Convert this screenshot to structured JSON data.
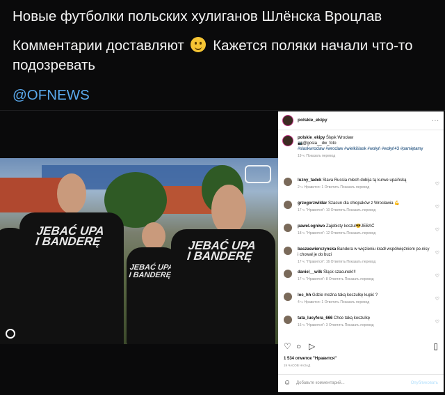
{
  "post": {
    "line1": "Новые футболки польских хулиганов Шлёнска Вроцлав",
    "line2_a": "Комментарии доставляют",
    "emoji": "smiling-face",
    "line2_b": "Кажется поляки начали что-то подозревать",
    "handle": "@OFNEWS"
  },
  "photo": {
    "shirt_text_1": "JEBAĆ UPA",
    "shirt_text_2": "I BANDERĘ",
    "shirt_text_3": "JEBAĆ UPA",
    "shirt_text_4": "I BANDERĘ",
    "shirt_text_5": "JEBAĆ UPA",
    "shirt_text_6": "I BANDERĘ"
  },
  "instagram": {
    "username": "polskie_ekipy",
    "more": "···",
    "caption": {
      "user": "polskie_ekipy",
      "text": "Śląsk Wrocław",
      "credit": "📷@gosia__dw_foto",
      "hashtags": "#slaskwroclaw #wroclaw #wielkiślask #wołyń #wołyń43 #pamiętamy",
      "meta": "19 ч.   Показать перевод"
    },
    "comments": [
      {
        "user": "luzny_tadek",
        "text": "Slava Russia mlech dobija tą kurwe upaińską",
        "meta": "2 ч.   Нравится: 1   Ответить   Показать перевод"
      },
      {
        "user": "grzegorzwildar",
        "text": "Szacun dla chłopaków z Wrocławia 💪",
        "meta": "17 ч.   \"Нравится\": 10   Ответить   Показать перевод"
      },
      {
        "user": "pawel.ogniwo",
        "text": "Zajebisty koszul😎JEBAĆ",
        "meta": "18 ч.   \"Нравится\": 12   Ответить   Показать перевод"
      },
      {
        "user": "baszaswierczynska",
        "text": "Bandera w więzieniu kradł współwięźniom pe.nisy i chował je do buzi",
        "meta": "17 ч.   \"Нравится\": 16   Ответить   Показать перевод"
      },
      {
        "user": "daniel__wilk",
        "text": "Śląsk szacunek!!!",
        "meta": "17 ч.   \"Нравится\": 8   Ответить   Показать перевод"
      },
      {
        "user": "loc_hh",
        "text": "Gdzie można taką koszulkę kupić ?",
        "meta": "4 ч.   Нравится: 1   Ответить   Показать перевод"
      },
      {
        "user": "tata_lucyfera_666",
        "text": "Chce taką koszulkę",
        "meta": "16 ч.   \"Нравится\": 3   Ответить   Показать перевод"
      }
    ],
    "likes": "1 534 отметок \"Нравится\"",
    "time": "19 ЧАСОВ НАЗАД",
    "add_comment_placeholder": "Добавьте комментарий...",
    "publish": "Опубликовать"
  }
}
